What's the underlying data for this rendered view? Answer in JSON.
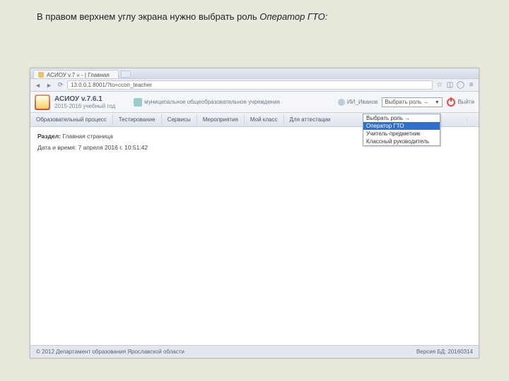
{
  "instruction": {
    "prefix": "В правом верхнем углу экрана нужно выбрать роль ",
    "italic": "Оператор ГТО:"
  },
  "browser": {
    "tab_title": "АСИОУ v.7 « - | Главная",
    "url": "13.0.0.1:8001/?to=ссоп_teacher"
  },
  "app": {
    "title": "АСИОУ v.7.6.1",
    "year": "2015-2016 учебный год",
    "org": "муниципальное общеобразовательное учреждение",
    "user": "ИИ_Иванов",
    "role_selected": "Выбрать роль →",
    "role_options": [
      "Выбрать роль →",
      "Оператор ГТО",
      "Учитель-предметник",
      "Классный руководитель"
    ],
    "exit": "Выйти"
  },
  "menu": {
    "items": [
      "Образовательный процесс",
      "Тестирование",
      "Сервисы",
      "Мероприятия",
      "Мой класс",
      "Для аттестации"
    ],
    "right": ""
  },
  "content": {
    "section_label": "Раздел:",
    "section_value": "Главная страница",
    "datetime_label": "Дата и время:",
    "datetime_value": "7 апреля 2016 г. 10:51:42"
  },
  "footer": {
    "copyright": "© 2012 Департамент образования Ярославской области",
    "version": "Версия БД: 20160314"
  }
}
